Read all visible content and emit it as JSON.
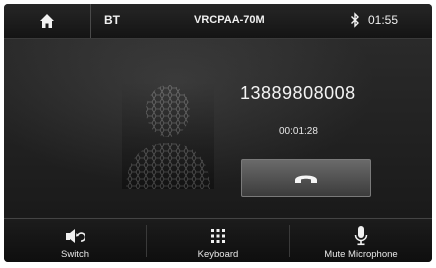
{
  "header": {
    "bt_label": "BT",
    "device_name": "VRCPAA-70M",
    "clock": "01:55",
    "home_icon": "home-icon",
    "status_icon": "bluetooth-icon"
  },
  "call": {
    "number": "13889808008",
    "duration": "00:01:28",
    "end_call_icon": "hang-up-icon"
  },
  "bottom_bar": {
    "switch_label": "Switch",
    "keyboard_label": "Keyboard",
    "mute_label": "Mute Microphone"
  },
  "colors": {
    "background": "#1b1b1b",
    "text": "#f0f0f0",
    "button": "#555555"
  }
}
